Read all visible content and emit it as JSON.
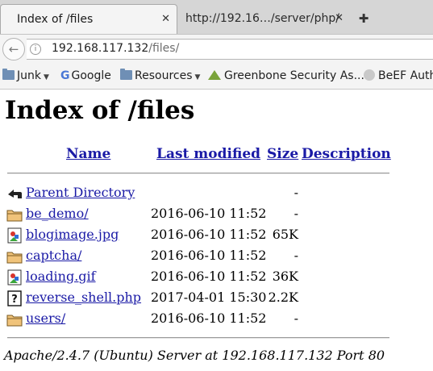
{
  "browser": {
    "tabs": [
      {
        "label": "Index of /files",
        "close": "✕"
      },
      {
        "label": "http://192.16…/server/php/",
        "close": "✕"
      }
    ],
    "new_tab": "✚",
    "back_icon": "back-arrow-icon",
    "url": {
      "host": "192.168.117.132",
      "path": "/files/"
    },
    "bookmarks": [
      {
        "label": "Junk",
        "icon": "folder-icon",
        "dropdown": "▼"
      },
      {
        "label": "Google",
        "icon": "google-icon"
      },
      {
        "label": "Resources",
        "icon": "folder-icon",
        "dropdown": "▼"
      },
      {
        "label": "Greenbone Security As...",
        "icon": "greenbone-icon"
      },
      {
        "label": "BeEF Authe",
        "icon": "beef-icon"
      }
    ]
  },
  "page": {
    "title": "Index of /files",
    "columns": {
      "name": "Name",
      "modified": "Last modified",
      "size": "Size",
      "description": "Description"
    },
    "rows": [
      {
        "name": "Parent Directory",
        "modified": "",
        "size": "-",
        "icon": "back-folder-icon"
      },
      {
        "name": "be_demo/",
        "modified": "2016-06-10 11:52",
        "size": "-",
        "icon": "folder-icon"
      },
      {
        "name": "blogimage.jpg",
        "modified": "2016-06-10 11:52",
        "size": "65K",
        "icon": "image-icon"
      },
      {
        "name": "captcha/",
        "modified": "2016-06-10 11:52",
        "size": "-",
        "icon": "folder-icon"
      },
      {
        "name": "loading.gif",
        "modified": "2016-06-10 11:52",
        "size": "36K",
        "icon": "image-icon"
      },
      {
        "name": "reverse_shell.php",
        "modified": "2017-04-01 15:30",
        "size": "2.2K",
        "icon": "unknown-file-icon"
      },
      {
        "name": "users/",
        "modified": "2016-06-10 11:52",
        "size": "-",
        "icon": "folder-icon"
      }
    ],
    "footer": "Apache/2.4.7 (Ubuntu) Server at 192.168.117.132 Port 80"
  }
}
